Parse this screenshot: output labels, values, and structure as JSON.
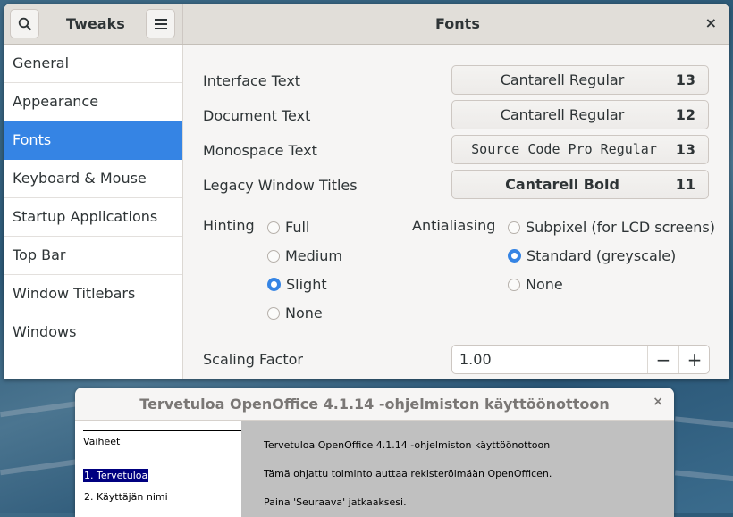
{
  "tweaks": {
    "app_title": "Tweaks",
    "page_title": "Fonts",
    "sidebar": {
      "items": [
        {
          "label": "General"
        },
        {
          "label": "Appearance"
        },
        {
          "label": "Fonts",
          "active": true
        },
        {
          "label": "Keyboard & Mouse"
        },
        {
          "label": "Startup Applications"
        },
        {
          "label": "Top Bar"
        },
        {
          "label": "Window Titlebars"
        },
        {
          "label": "Windows"
        }
      ]
    },
    "fonts": [
      {
        "label": "Interface Text",
        "font": "Cantarell Regular",
        "size": "13"
      },
      {
        "label": "Document Text",
        "font": "Cantarell Regular",
        "size": "12"
      },
      {
        "label": "Monospace Text",
        "font": "Source Code Pro Regular",
        "size": "13"
      },
      {
        "label": "Legacy Window Titles",
        "font": "Cantarell Bold",
        "size": "11"
      }
    ],
    "hinting": {
      "label": "Hinting",
      "options": [
        "Full",
        "Medium",
        "Slight",
        "None"
      ],
      "selected": "Slight"
    },
    "antialiasing": {
      "label": "Antialiasing",
      "options": [
        "Subpixel (for LCD screens)",
        "Standard (greyscale)",
        "None"
      ],
      "selected": "Standard (greyscale)"
    },
    "scaling": {
      "label": "Scaling Factor",
      "value": "1.00",
      "decrement": "−",
      "increment": "+"
    },
    "accent_color": "#3584e4"
  },
  "openoffice": {
    "title": "Tervetuloa OpenOffice 4.1.14 -ohjelmiston käyttöönottoon",
    "close": "×",
    "steps_title": "Vaiheet",
    "steps": [
      "1. Tervetuloa",
      "2. Käyttäjän nimi"
    ],
    "active_step": "1. Tervetuloa",
    "paragraphs": [
      "Tervetuloa OpenOffice 4.1.14 -ohjelmiston käyttöönottoon",
      "Tämä ohjattu toiminto auttaa rekisteröimään OpenOfficen.",
      "Paina 'Seuraava' jatkaaksesi."
    ]
  },
  "icons": {
    "close": "×"
  }
}
